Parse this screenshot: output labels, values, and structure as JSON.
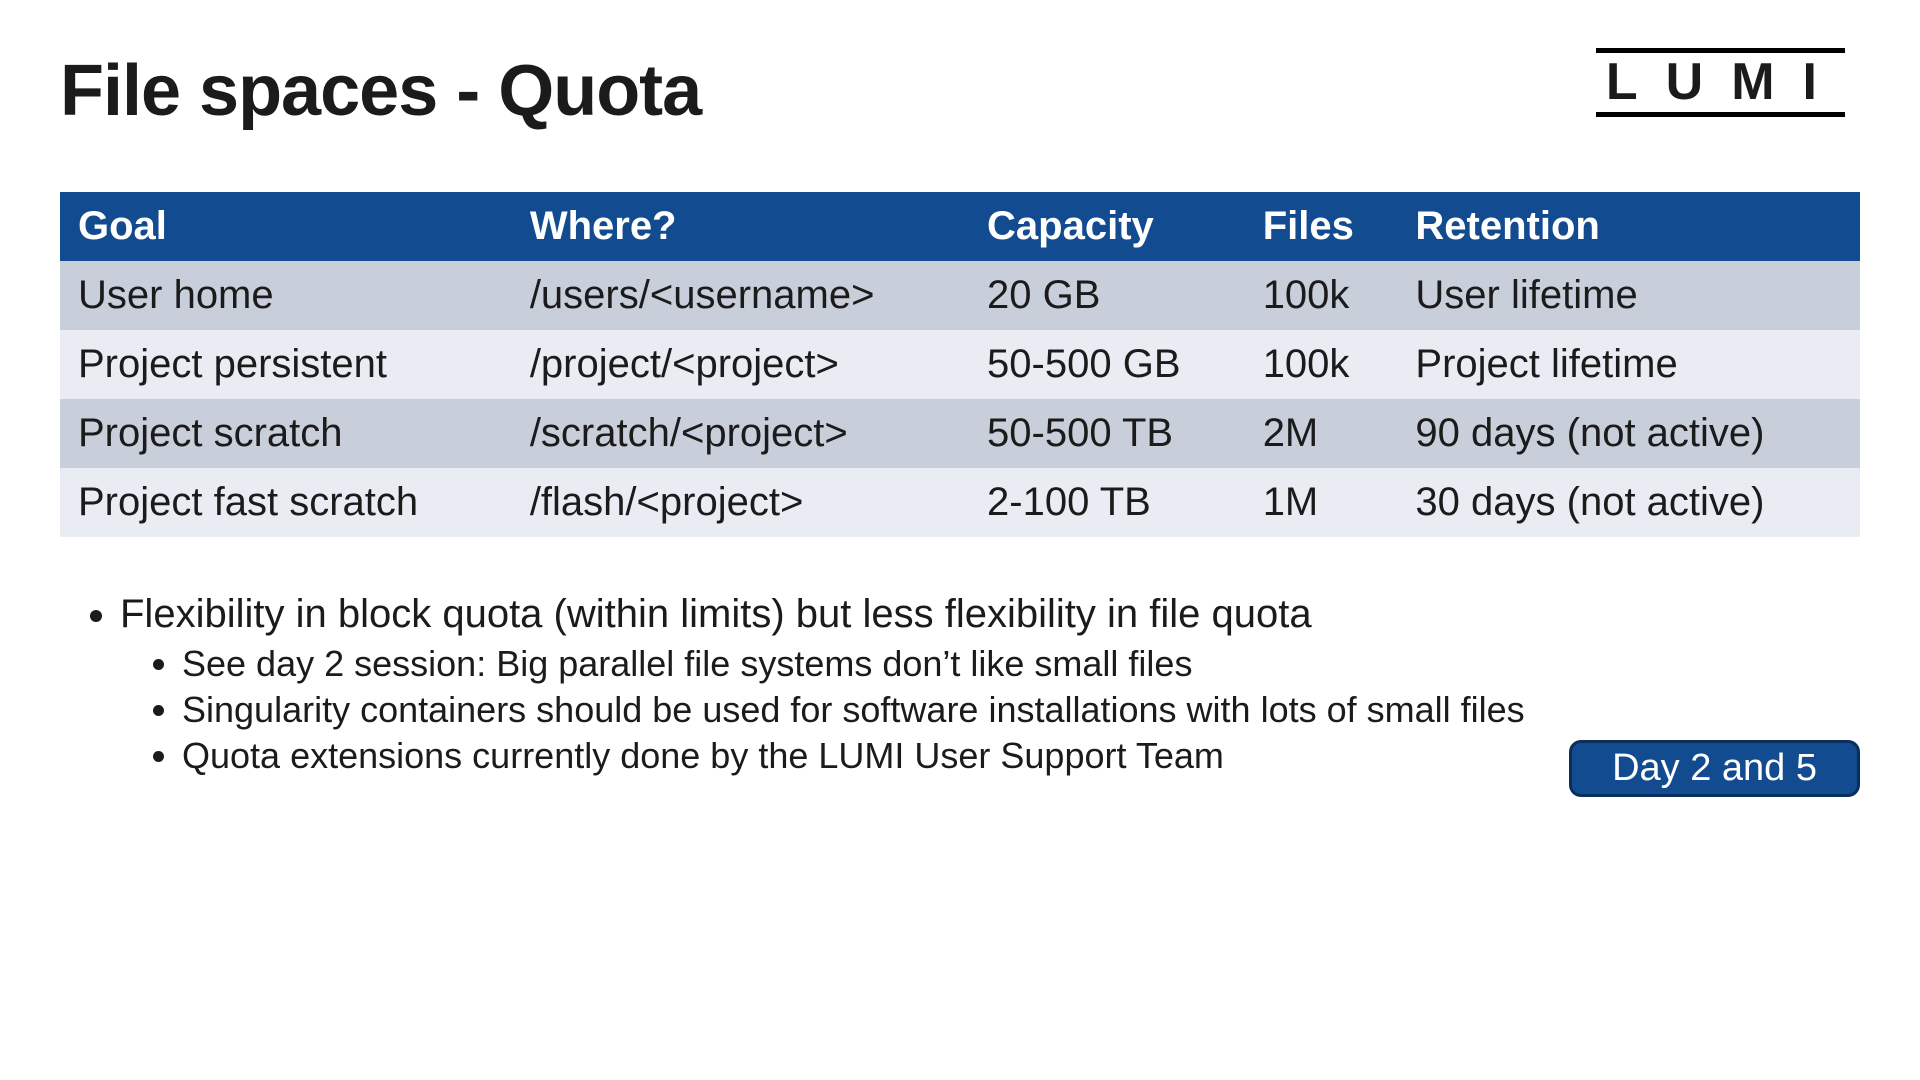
{
  "title": "File spaces - Quota",
  "logo_text": "LUMI",
  "table": {
    "headers": [
      "Goal",
      "Where?",
      "Capacity",
      "Files",
      "Retention"
    ],
    "rows": [
      [
        "User home",
        "/users/<username>",
        "20 GB",
        "100k",
        "User lifetime"
      ],
      [
        "Project persistent",
        "/project/<project>",
        "50-500 GB",
        "100k",
        "Project lifetime"
      ],
      [
        "Project scratch",
        "/scratch/<project>",
        "50-500 TB",
        "2M",
        "90 days (not active)"
      ],
      [
        "Project fast scratch",
        "/flash/<project>",
        "2-100 TB",
        "1M",
        "30 days (not active)"
      ]
    ]
  },
  "bullets": {
    "b1": "Flexibility in block quota (within limits) but less flexibility in file quota",
    "b1a": "See day 2 session: Big parallel file systems don’t like small files",
    "b1b": "Singularity containers should be used for software installations with lots of small files",
    "b1c": "Quota extensions currently done by the LUMI User Support Team"
  },
  "badge": "Day 2 and 5"
}
